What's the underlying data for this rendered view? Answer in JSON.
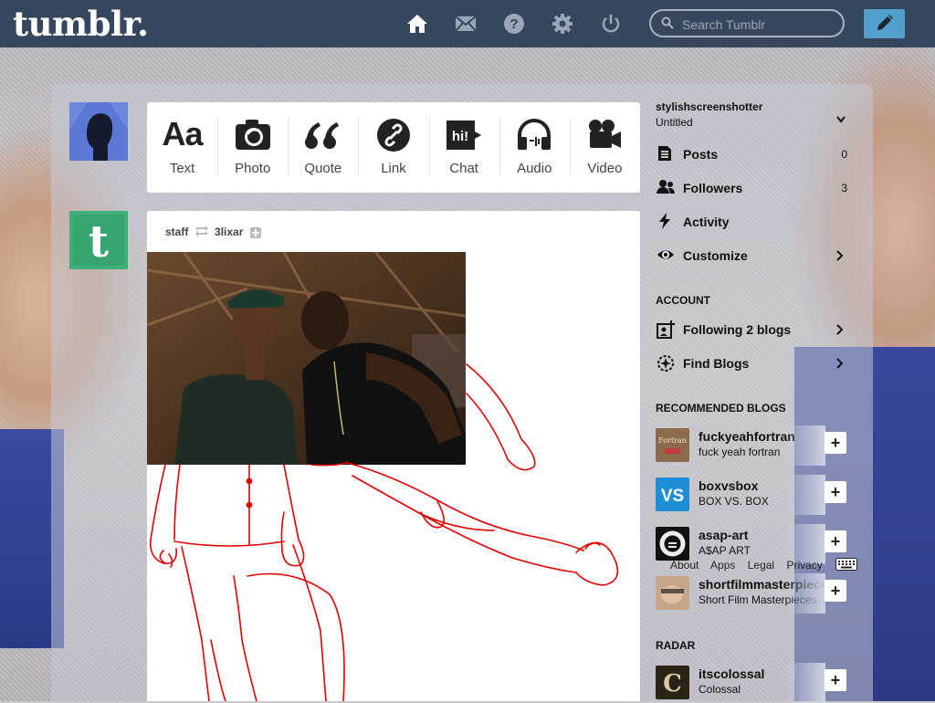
{
  "header": {
    "logo": "tumblr.",
    "search_placeholder": "Search Tumblr"
  },
  "post_types": [
    {
      "label": "Text",
      "icon": "text-icon",
      "glyph": "Aa"
    },
    {
      "label": "Photo",
      "icon": "camera-icon"
    },
    {
      "label": "Quote",
      "icon": "quote-icon"
    },
    {
      "label": "Link",
      "icon": "link-icon"
    },
    {
      "label": "Chat",
      "icon": "chat-icon"
    },
    {
      "label": "Audio",
      "icon": "headphones-icon"
    },
    {
      "label": "Video",
      "icon": "video-camera-icon"
    }
  ],
  "post": {
    "author": "staff",
    "reblogged_from": "3lixar"
  },
  "sidebar": {
    "blog_name": "stylishscreenshotter",
    "blog_title": "Untitled",
    "stats": [
      {
        "label": "Posts",
        "count": "0",
        "icon": "posts-icon"
      },
      {
        "label": "Followers",
        "count": "3",
        "icon": "followers-icon"
      },
      {
        "label": "Activity",
        "icon": "activity-icon"
      },
      {
        "label": "Customize",
        "icon": "eye-icon"
      }
    ],
    "account_heading": "ACCOUNT",
    "account_items": [
      {
        "label": "Following 2 blogs",
        "icon": "following-icon"
      },
      {
        "label": "Find Blogs",
        "icon": "compass-icon"
      }
    ],
    "recommended_heading": "RECOMMENDED BLOGS",
    "recommended": [
      {
        "name": "fuckyeahfortran",
        "desc": "fuck yeah fortran"
      },
      {
        "name": "boxvsbox",
        "desc": "BOX VS. BOX"
      },
      {
        "name": "asap-art",
        "desc": "A$AP ART"
      },
      {
        "name": "shortfilmmasterpieces",
        "desc": "Short Film Masterpieces"
      }
    ],
    "radar_heading": "RADAR",
    "radar": [
      {
        "name": "itscolossal",
        "desc": "Colossal"
      }
    ]
  },
  "footer": {
    "links": [
      "About",
      "Apps",
      "Legal",
      "Privacy"
    ]
  },
  "colors": {
    "header_bg": "#36465d",
    "compose_bg": "#529ecc",
    "sketch_red": "#e00000"
  }
}
